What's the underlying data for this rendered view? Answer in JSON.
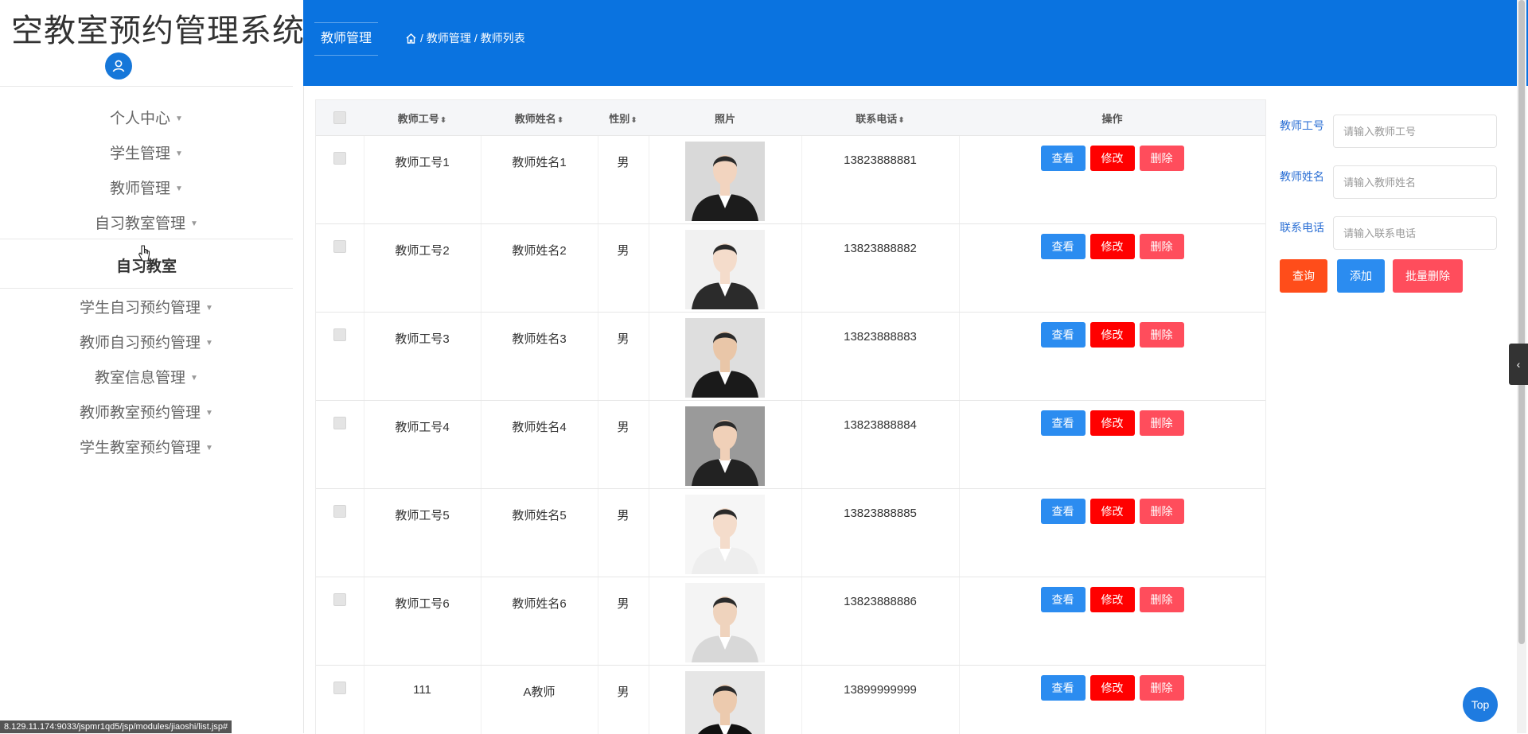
{
  "app": {
    "title": "空教室预约管理系统"
  },
  "sidebar": {
    "menus": [
      {
        "label": "个人中心",
        "has_dropdown": true
      },
      {
        "label": "学生管理",
        "has_dropdown": true
      },
      {
        "label": "教师管理",
        "has_dropdown": true
      },
      {
        "label": "自习教室管理",
        "has_dropdown": true
      },
      {
        "label": "自习教室",
        "has_dropdown": false
      },
      {
        "label": "学生自习预约管理",
        "has_dropdown": true
      },
      {
        "label": "教师自习预约管理",
        "has_dropdown": true
      },
      {
        "label": "教室信息管理",
        "has_dropdown": true
      },
      {
        "label": "教师教室预约管理",
        "has_dropdown": true
      },
      {
        "label": "学生教室预约管理",
        "has_dropdown": true
      }
    ]
  },
  "header": {
    "tab": "教师管理",
    "breadcrumb": {
      "sep": "/",
      "level1": "教师管理",
      "level2": "教师列表"
    }
  },
  "table": {
    "columns": {
      "id": "教师工号",
      "name": "教师姓名",
      "gender": "性别",
      "photo": "照片",
      "phone": "联系电话",
      "actions": "操作"
    },
    "rows": [
      {
        "id": "教师工号1",
        "name": "教师姓名1",
        "gender": "男",
        "phone": "13823888881"
      },
      {
        "id": "教师工号2",
        "name": "教师姓名2",
        "gender": "男",
        "phone": "13823888882"
      },
      {
        "id": "教师工号3",
        "name": "教师姓名3",
        "gender": "男",
        "phone": "13823888883"
      },
      {
        "id": "教师工号4",
        "name": "教师姓名4",
        "gender": "男",
        "phone": "13823888884"
      },
      {
        "id": "教师工号5",
        "name": "教师姓名5",
        "gender": "男",
        "phone": "13823888885"
      },
      {
        "id": "教师工号6",
        "name": "教师姓名6",
        "gender": "男",
        "phone": "13823888886"
      },
      {
        "id": "111",
        "name": "A教师",
        "gender": "男",
        "phone": "13899999999"
      }
    ],
    "row_actions": {
      "view": "查看",
      "edit": "修改",
      "delete": "删除"
    }
  },
  "search": {
    "fields": [
      {
        "label": "教师工号",
        "placeholder": "请输入教师工号"
      },
      {
        "label": "教师姓名",
        "placeholder": "请输入教师姓名"
      },
      {
        "label": "联系电话",
        "placeholder": "请输入联系电话"
      }
    ],
    "buttons": {
      "query": "查询",
      "add": "添加",
      "batch_delete": "批量删除"
    }
  },
  "misc": {
    "top_button": "Top",
    "status_url": "8.129.11.174:9033/jspmr1qd5/jsp/modules/jiaoshi/list.jsp#"
  },
  "colors": {
    "header_bg": "#0a73e0",
    "view_btn": "#2b8cf0",
    "edit_btn": "#ff0000",
    "delete_btn": "#ff4d5c",
    "query_btn": "#ff4d1a"
  }
}
